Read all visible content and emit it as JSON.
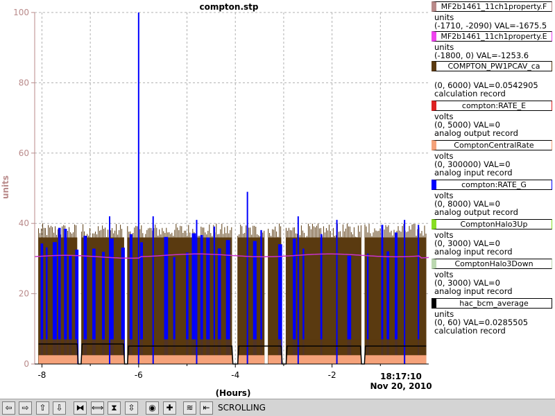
{
  "chart_data": {
    "type": "line",
    "title": "compton.stp",
    "xlabel": "(Hours)",
    "ylabel": "units",
    "ylim": [
      0,
      100
    ],
    "yticks": [
      "0",
      "20",
      "40",
      "60",
      "80",
      "100"
    ],
    "xlim": [
      -8.15,
      0
    ],
    "xticks": [
      "-8",
      "-6",
      "-4",
      "-2"
    ],
    "time_label": "18:17:10",
    "date_label": "Nov 20, 2010",
    "grid": true,
    "series": [
      {
        "name": "MF2b1461_11ch1property.E",
        "color": "#cc33cc",
        "value_approx": 30.5
      },
      {
        "name": "compton:RATE_G",
        "color": "#0000ff",
        "peak": 100
      },
      {
        "name": "COMPTON_PW1PCAV_ca",
        "color": "#5a3a10",
        "peak": 40
      },
      {
        "name": "ComptonCentralRate",
        "color": "#f5a27a",
        "peak": 3
      },
      {
        "name": "hac_bcm_average",
        "color": "#000000",
        "value_approx": 5.5
      }
    ]
  },
  "legend": [
    {
      "name": "MF2b1461_11ch1property.F",
      "color": "#b98a8a",
      "units": "units",
      "range": "(-1710, -2090) VAL=-1675.5",
      "rtype": ""
    },
    {
      "name": "MF2b1461_11ch1property.E",
      "color": "#ee44ee",
      "units": "units",
      "range": "(-1800, 0) VAL=-1253.6",
      "rtype": ""
    },
    {
      "name": "COMPTON_PW1PCAV_ca",
      "color": "#5a3a10",
      "units": "",
      "range": "(0, 6000) VAL=0.0542905",
      "rtype": "calculation record"
    },
    {
      "name": "compton:RATE_E",
      "color": "#dd2222",
      "units": "volts",
      "range": "(0, 5000) VAL=0",
      "rtype": "analog output record"
    },
    {
      "name": "ComptonCentralRate",
      "color": "#f5a27a",
      "units": "volts",
      "range": "(0, 300000) VAL=0",
      "rtype": "analog input record"
    },
    {
      "name": "compton:RATE_G",
      "color": "#0000ff",
      "units": "volts",
      "range": "(0, 8000) VAL=0",
      "rtype": "analog output record"
    },
    {
      "name": "ComptonHalo3Up",
      "color": "#88dd22",
      "units": "volts",
      "range": "(0, 3000) VAL=0",
      "rtype": "analog input record"
    },
    {
      "name": "ComptonHalo3Down",
      "color": "#bbd8b0",
      "units": "volts",
      "range": "(0, 3000) VAL=0",
      "rtype": "analog input record"
    },
    {
      "name": "hac_bcm_average",
      "color": "#000000",
      "units": "units",
      "range": "(0, 60) VAL=0.0285505",
      "rtype": "calculation record"
    }
  ],
  "toolbar": {
    "status": "SCROLLING",
    "buttons": [
      {
        "name": "pan-left-button",
        "icon": "arrow-left-icon",
        "glyph": "⇦"
      },
      {
        "name": "pan-right-button",
        "icon": "arrow-right-icon",
        "glyph": "⇨"
      },
      {
        "name": "pan-up-button",
        "icon": "arrow-up-icon",
        "glyph": "⇧"
      },
      {
        "name": "pan-down-button",
        "icon": "arrow-down-icon",
        "glyph": "⇩"
      },
      {
        "name": "zoom-in-x-button",
        "icon": "zoom-in-x-icon",
        "glyph": "⧓"
      },
      {
        "name": "zoom-out-x-button",
        "icon": "zoom-out-x-icon",
        "glyph": "⟺"
      },
      {
        "name": "zoom-in-y-button",
        "icon": "zoom-in-y-icon",
        "glyph": "⧗"
      },
      {
        "name": "zoom-out-y-button",
        "icon": "zoom-out-y-icon",
        "glyph": "⇳"
      },
      {
        "name": "stop-button",
        "icon": "stop-icon",
        "glyph": "◉"
      },
      {
        "name": "add-button",
        "icon": "plus-icon",
        "glyph": "✚"
      },
      {
        "name": "scroll-mode-button",
        "icon": "scroll-icon",
        "glyph": "≋"
      },
      {
        "name": "jump-end-button",
        "icon": "jump-end-icon",
        "glyph": "⇤"
      }
    ]
  }
}
